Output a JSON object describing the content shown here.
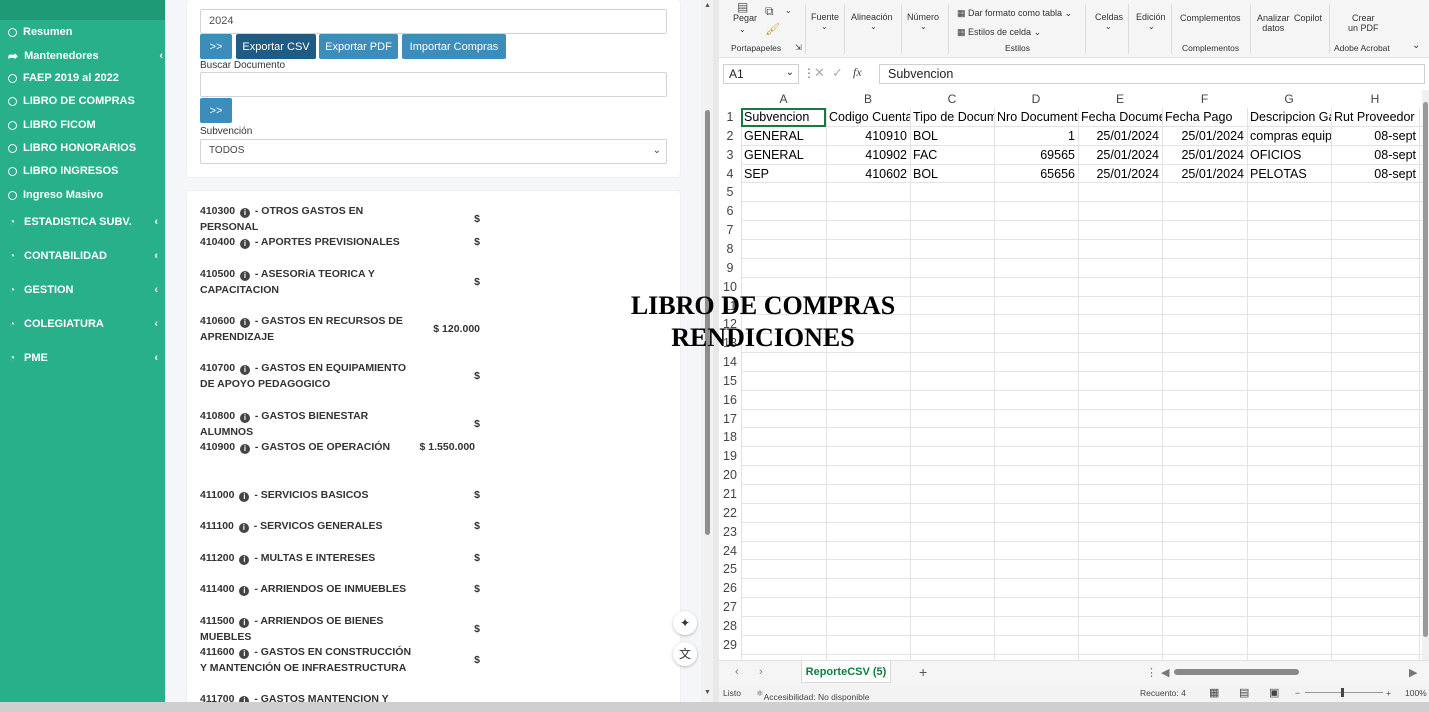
{
  "sidebar": {
    "sub_items": [
      {
        "label": "Resumen",
        "icon": "circle-icon"
      },
      {
        "label": "Mantenedores",
        "icon": "share-icon"
      },
      {
        "label": "FAEP 2019 al 2022",
        "icon": "circle-icon"
      },
      {
        "label": "LIBRO DE COMPRAS",
        "icon": "circle-icon"
      },
      {
        "label": "LIBRO FICOM",
        "icon": "circle-icon"
      },
      {
        "label": "LIBRO HONORARIOS",
        "icon": "circle-icon"
      },
      {
        "label": "LIBRO INGRESOS",
        "icon": "circle-icon"
      },
      {
        "label": "Ingreso Masivo",
        "icon": "circle-icon"
      }
    ],
    "main_items": [
      {
        "label": "ESTADISTICA SUBV.",
        "icon": "dashboard-icon"
      },
      {
        "label": "CONTABILIDAD",
        "icon": "dashboard-icon"
      },
      {
        "label": "GESTION",
        "icon": "dashboard-icon"
      },
      {
        "label": "COLEGIATURA",
        "icon": "dashboard-icon"
      },
      {
        "label": "PME",
        "icon": "dashboard-icon"
      }
    ]
  },
  "filter": {
    "year_value": "2024",
    "go_button": ">>",
    "export_csv": "Exportar CSV",
    "export_pdf": "Exportar PDF",
    "import_compras": "Importar Compras",
    "buscar_label": "Buscar Documento",
    "buscar_value": "",
    "go_button_2": ">>",
    "subvencion_label": "Subvención",
    "subvencion_value": "TODOS"
  },
  "accounts": [
    {
      "name": "410300",
      "desc": "- OTROS GASTOS EN PERSONAL",
      "amount": "$"
    },
    {
      "name": "410400",
      "desc": "- APORTES PREVISIONALES",
      "amount": "$"
    },
    {
      "name": "410500",
      "desc": "- ASESORiA TEORICA Y CAPACITACION",
      "amount": "$"
    },
    {
      "name": "410600",
      "desc": "- GASTOS EN RECURSOS DE APRENDIZAJE",
      "amount": "$ 120.000"
    },
    {
      "name": "410700",
      "desc": "- GASTOS EN EQUIPAMIENTO DE APOYO PEDAGOGICO",
      "amount": "$"
    },
    {
      "name": "410800",
      "desc": "- GASTOS BIENESTAR ALUMNOS",
      "amount": "$"
    },
    {
      "name": "410900",
      "desc": "- GASTOS OE OPERACIÓN",
      "amount": "$ 1.550.000"
    },
    {
      "name": "411000",
      "desc": "- SERVICIOS BASICOS",
      "amount": "$"
    },
    {
      "name": "411100",
      "desc": "- SERVICOS GENERALES",
      "amount": "$"
    },
    {
      "name": "411200",
      "desc": "- MULTAS E INTERESES",
      "amount": "$"
    },
    {
      "name": "411400",
      "desc": "- ARRIENDOS OE INMUEBLES",
      "amount": "$"
    },
    {
      "name": "411500",
      "desc": "- ARRIENDOS OE BIENES MUEBLES",
      "amount": "$"
    },
    {
      "name": "411600",
      "desc": "- GASTOS EN CONSTRUCCIÓN Y MANTENCIÓN OE INFRAESTRUCTURA",
      "amount": "$"
    },
    {
      "name": "411700",
      "desc": "- GASTOS MANTENCION Y",
      "amount": ""
    }
  ],
  "overlay_title": {
    "line1": "LIBRO DE COMPRAS",
    "line2": "RENDICIONES"
  },
  "excel": {
    "ribbon": {
      "pegar": "Pegar",
      "portapapeles": "Portapapeles",
      "fuente": "Fuente",
      "alineacion": "Alineación",
      "numero": "Número",
      "dar_formato": "Dar formato como tabla",
      "estilos_celda": "Estilos de celda",
      "estilos": "Estilos",
      "celdas": "Celdas",
      "edicion": "Edición",
      "complementos_btn": "Complementos",
      "complementos_grp": "Complementos",
      "analizar_1": "Analizar",
      "analizar_2": "datos",
      "copilot": "Copilot",
      "crear_1": "Crear",
      "crear_2": "un PDF",
      "adobe": "Adobe Acrobat"
    },
    "name_box": "A1",
    "fx": "fx",
    "formula": "Subvencion",
    "columns": [
      "A",
      "B",
      "C",
      "D",
      "E",
      "F",
      "G",
      "H"
    ],
    "rows": [
      [
        "Subvencion",
        "Codigo Cuenta",
        "Tipo de Documento",
        "Nro Documento",
        "Fecha Documento",
        "Fecha Pago",
        "Descripcion Gasto",
        "Rut Proveedor"
      ],
      [
        "GENERAL",
        "410910",
        "BOL",
        "1",
        "25/01/2024",
        "25/01/2024",
        "compras equipo",
        "08-sept"
      ],
      [
        "GENERAL",
        "410902",
        "FAC",
        "69565",
        "25/01/2024",
        "25/01/2024",
        "OFICIOS",
        "08-sept"
      ],
      [
        "SEP",
        "410602",
        "BOL",
        "65656",
        "25/01/2024",
        "25/01/2024",
        "PELOTAS",
        "08-sept"
      ]
    ],
    "row_numbers": [
      "1",
      "2",
      "3",
      "4",
      "5",
      "6",
      "7",
      "8",
      "9",
      "10",
      "11",
      "12",
      "13",
      "14",
      "15",
      "16",
      "17",
      "18",
      "19",
      "20",
      "21",
      "22",
      "23",
      "24",
      "25",
      "26",
      "27",
      "28",
      "29"
    ],
    "sheet_tab": "ReporteCSV (5)",
    "status": {
      "ready": "Listo",
      "accessibility": "Accesibilidad: No disponible",
      "count": "Recuento: 4",
      "zoom": "100%"
    }
  }
}
